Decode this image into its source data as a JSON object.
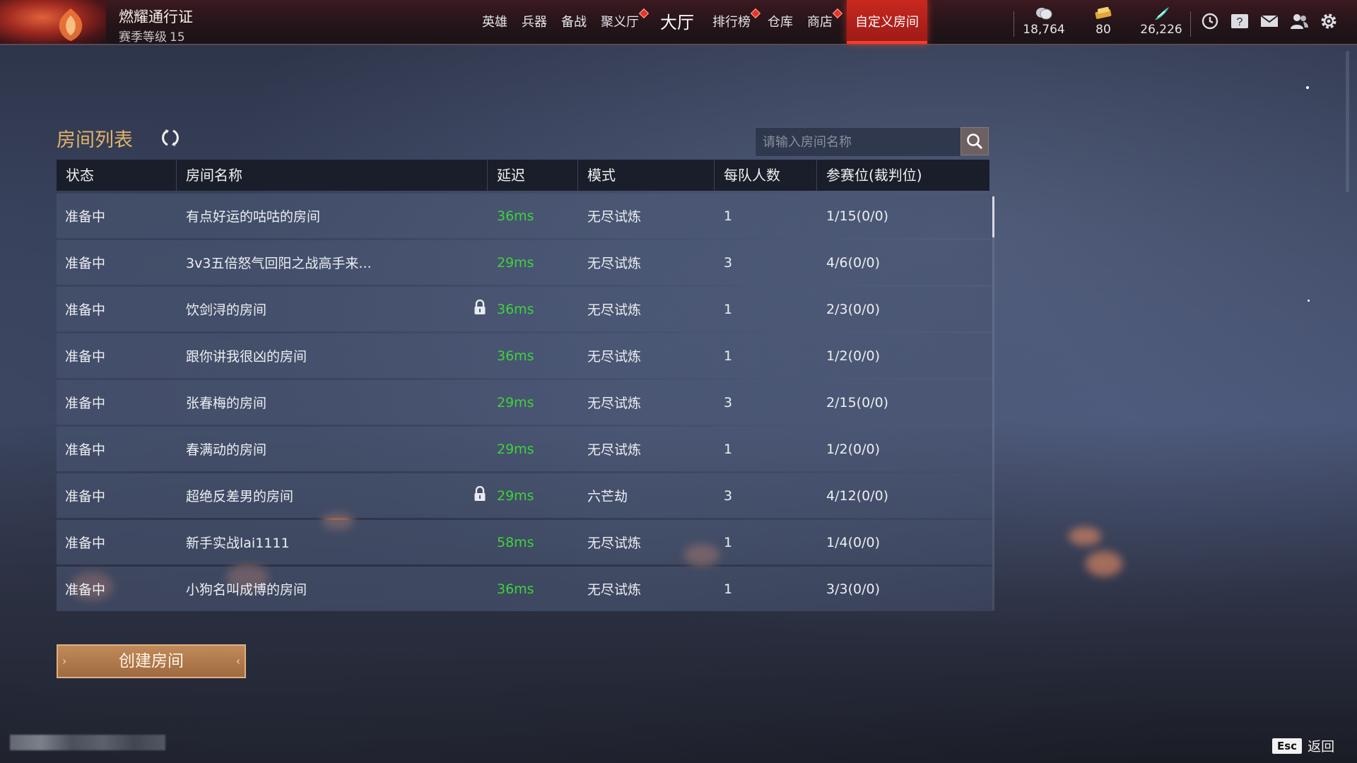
{
  "pass": {
    "title": "燃耀通行证",
    "level_label": "赛季等级",
    "level_value": "15"
  },
  "nav": {
    "items": [
      {
        "label": "英雄",
        "badge": false
      },
      {
        "label": "兵器",
        "badge": false
      },
      {
        "label": "备战",
        "badge": false
      },
      {
        "label": "聚义厅",
        "badge": true
      },
      {
        "label": "大厅",
        "badge": false
      },
      {
        "label": "排行榜",
        "badge": true
      },
      {
        "label": "仓库",
        "badge": false
      },
      {
        "label": "商店",
        "badge": true
      },
      {
        "label": "自定义房间",
        "badge": false
      }
    ],
    "active": "自定义房间"
  },
  "currencies": [
    {
      "icon": "coin-stack-icon",
      "value": "18,764"
    },
    {
      "icon": "gold-ticket-icon",
      "value": "80"
    },
    {
      "icon": "feather-token-icon",
      "value": "26,226"
    }
  ],
  "top_icons": [
    "clock-icon",
    "help-icon",
    "mail-icon",
    "friends-icon",
    "gear-icon"
  ],
  "room_list": {
    "title": "房间列表",
    "search_placeholder": "请输入房间名称",
    "columns": [
      "状态",
      "房间名称",
      "延迟",
      "模式",
      "每队人数",
      "参赛位(裁判位)"
    ],
    "rows": [
      {
        "status": "准备中",
        "name": "有点好运的咕咕的房间",
        "locked": false,
        "ping": "36ms",
        "mode": "无尽试炼",
        "team_size": "1",
        "slots": "1/15(0/0)"
      },
      {
        "status": "准备中",
        "name": "3v3五倍怒气回阳之战高手来...",
        "locked": false,
        "ping": "29ms",
        "mode": "无尽试炼",
        "team_size": "3",
        "slots": "4/6(0/0)"
      },
      {
        "status": "准备中",
        "name": "饮剑浔的房间",
        "locked": true,
        "ping": "36ms",
        "mode": "无尽试炼",
        "team_size": "1",
        "slots": "2/3(0/0)"
      },
      {
        "status": "准备中",
        "name": "跟你讲我很凶的房间",
        "locked": false,
        "ping": "36ms",
        "mode": "无尽试炼",
        "team_size": "1",
        "slots": "1/2(0/0)"
      },
      {
        "status": "准备中",
        "name": "张春梅的房间",
        "locked": false,
        "ping": "29ms",
        "mode": "无尽试炼",
        "team_size": "3",
        "slots": "2/15(0/0)"
      },
      {
        "status": "准备中",
        "name": "春满动的房间",
        "locked": false,
        "ping": "29ms",
        "mode": "无尽试炼",
        "team_size": "1",
        "slots": "1/2(0/0)"
      },
      {
        "status": "准备中",
        "name": "超绝反差男的房间",
        "locked": true,
        "ping": "29ms",
        "mode": "六芒劫",
        "team_size": "3",
        "slots": "4/12(0/0)"
      },
      {
        "status": "准备中",
        "name": "新手实战lai1111",
        "locked": false,
        "ping": "58ms",
        "mode": "无尽试炼",
        "team_size": "1",
        "slots": "1/4(0/0)"
      },
      {
        "status": "准备中",
        "name": "小狗名叫成博的房间",
        "locked": false,
        "ping": "36ms",
        "mode": "无尽试炼",
        "team_size": "1",
        "slots": "3/3(0/0)"
      }
    ]
  },
  "create_button": "创建房间",
  "footer": {
    "esc_key": "Esc",
    "esc_label": "返回"
  },
  "colors": {
    "accent": "#c8281f",
    "title_gold": "#e2b36a",
    "ping_green": "#3fd23c",
    "create_btn": "#a06a40"
  }
}
